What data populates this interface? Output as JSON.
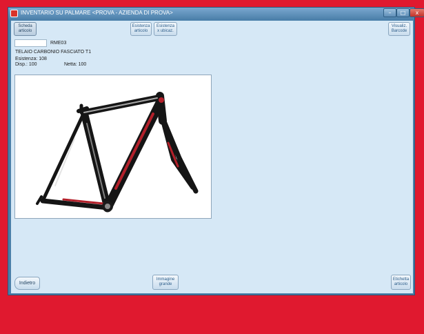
{
  "window": {
    "title": "INVENTARIO SU PALMARE <PROVA - AZIENDA DI PROVA>",
    "min_glyph": "–",
    "max_glyph": "□",
    "close_glyph": "x"
  },
  "toolbar": {
    "scheda_articolo": "Scheda articolo",
    "esistenza_articolo": "Esistenza articolo",
    "esistenza_ubicaz": "Esistenza x ubicaz.",
    "visualiz_barcode": "Visualiz. Barcode"
  },
  "article": {
    "code_input_value": "",
    "code": "RME03",
    "description": "TELAIO CARBONIO FASCIATO T1",
    "esistenza": "Esistenza: 108",
    "disp": "Disp.: 100",
    "netta": "Netta: 100"
  },
  "image": {
    "subject": "bicycle carbon frame",
    "colors": {
      "frame": "#151515",
      "accent": "#b3202a",
      "highlight": "#d9d9d9"
    }
  },
  "footer": {
    "indietro": "Indietro",
    "immagine_grande": "Immagine grande",
    "etichetta_articolo": "Etichetta articolo"
  }
}
